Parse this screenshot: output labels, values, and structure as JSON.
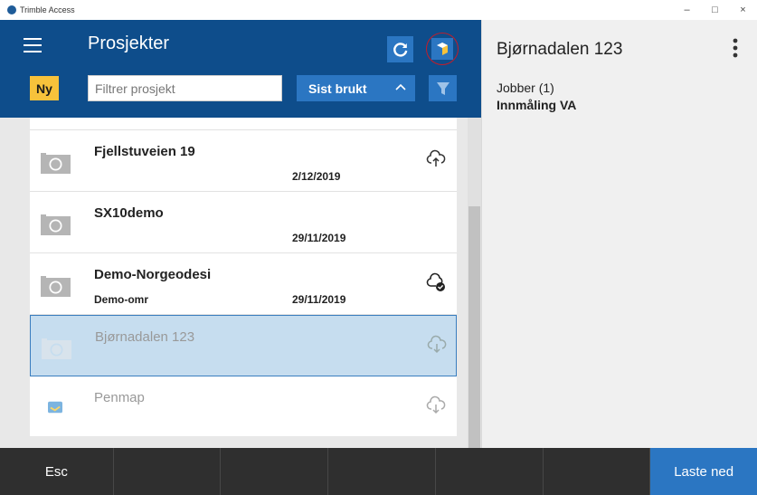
{
  "window": {
    "title": "Trimble Access",
    "minimize": "–",
    "maximize": "□",
    "close": "×"
  },
  "header": {
    "title": "Prosjekter",
    "new_label": "Ny",
    "filter_placeholder": "Filtrer prosjekt",
    "sort_label": "Sist brukt",
    "sort_chevron": "^"
  },
  "projects": [
    {
      "name": "Fjellstuveien 19",
      "sub": "",
      "date": "2/12/2019",
      "thumb": "camera-icon",
      "cloud": "cloud-upload-icon"
    },
    {
      "name": "SX10demo",
      "sub": "",
      "date": "29/11/2019",
      "thumb": "camera-icon",
      "cloud": ""
    },
    {
      "name": "Demo-Norgeodesi",
      "sub": "Demo-omr",
      "date": "29/11/2019",
      "thumb": "camera-icon",
      "cloud": "cloud-check-icon"
    },
    {
      "name": "Bjørnadalen 123",
      "sub": "",
      "date": "",
      "thumb": "camera-icon",
      "cloud": "cloud-download-icon",
      "selected": true
    },
    {
      "name": "Penmap",
      "sub": "",
      "date": "",
      "thumb": "penmap-icon",
      "cloud": "cloud-download-icon"
    }
  ],
  "detail": {
    "title": "Bjørnadalen 123",
    "jobs_label": "Jobber (1)",
    "job_name": "Innmåling VA"
  },
  "bottombar": {
    "esc_label": "Esc",
    "download_label": "Laste ned"
  },
  "colors": {
    "header": "#0e4d8b",
    "accent": "#2b76c2",
    "new_button": "#f7c23b",
    "selected_row": "#c6ddef",
    "bottombar": "#2f2f2f"
  }
}
